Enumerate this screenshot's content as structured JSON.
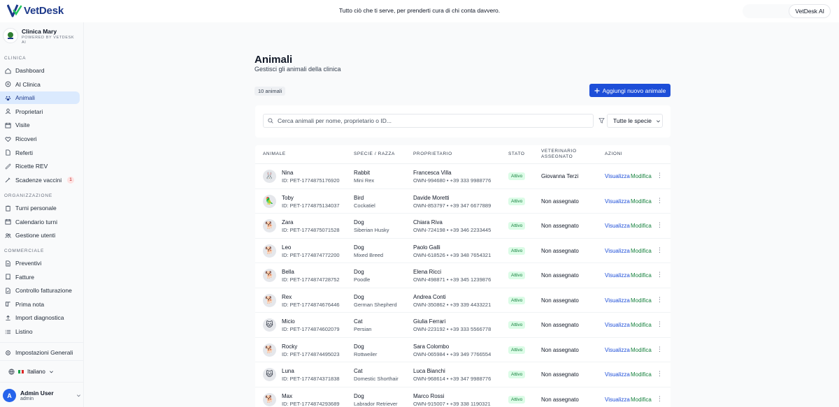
{
  "brand": {
    "name": "VetDesk",
    "tagline": "Tutto ciò che ti serve, per prenderti cura di chi conta davvero.",
    "ai_button": "VetDesk AI"
  },
  "clinic": {
    "name": "Clinica Mary",
    "powered": "POWERED BY VETDESK AI"
  },
  "nav": {
    "section_clinica": "CLINICA",
    "section_organizzazione": "ORGANIZZAZIONE",
    "section_commerciale": "COMMERCIALE",
    "clinica": [
      {
        "label": "Dashboard",
        "icon": "home-icon"
      },
      {
        "label": "AI Clinica",
        "icon": "ai-icon"
      },
      {
        "label": "Animali",
        "icon": "paw-icon"
      },
      {
        "label": "Proprietari",
        "icon": "user-icon"
      },
      {
        "label": "Visite",
        "icon": "calendar-icon"
      },
      {
        "label": "Ricoveri",
        "icon": "heart-icon"
      },
      {
        "label": "Referti",
        "icon": "file-icon"
      },
      {
        "label": "Ricette REV",
        "icon": "pill-icon"
      },
      {
        "label": "Scadenze vaccini",
        "icon": "syringe-icon",
        "badge": "1"
      }
    ],
    "organizzazione": [
      {
        "label": "Turni personale",
        "icon": "clipboard-icon"
      },
      {
        "label": "Calendario turni",
        "icon": "calendar-icon"
      },
      {
        "label": "Gestione utenti",
        "icon": "users-icon"
      }
    ],
    "commerciale": [
      {
        "label": "Preventivi",
        "icon": "document-icon"
      },
      {
        "label": "Fatture",
        "icon": "invoice-icon"
      },
      {
        "label": "Controllo fatturazione",
        "icon": "check-file-icon"
      },
      {
        "label": "Prima nota",
        "icon": "book-icon"
      },
      {
        "label": "Import diagnostica",
        "icon": "upload-icon"
      },
      {
        "label": "Listino",
        "icon": "list-icon"
      }
    ],
    "settings": "Impostazioni Generali",
    "language": "Italiano"
  },
  "user": {
    "initial": "A",
    "name": "Admin User",
    "role": "admin"
  },
  "page": {
    "title": "Animali",
    "subtitle": "Gestisci gli animali della clinica",
    "count": "10 animali",
    "add_button": "Aggiungi nuovo animale",
    "search_placeholder": "Cerca animali per nome, proprietario o ID...",
    "species_filter": "Tutte le specie"
  },
  "table": {
    "headers": {
      "animal": "ANIMALE",
      "species": "SPECIE / RAZZA",
      "owner": "PROPRIETARIO",
      "status": "STATO",
      "vet": "VETERINARIO ASSEGNATO",
      "actions": "AZIONI"
    },
    "view_label": "Visualizza",
    "edit_label": "Modifica",
    "rows": [
      {
        "name": "Nina",
        "id": "ID: PET-1774875176920",
        "species": "Rabbit",
        "breed": "Mini Rex",
        "owner": "Francesca Villa",
        "owner_info": "OWN-994680 • +39 333 9988776",
        "status": "Attivo",
        "vet": "Giovanna Terzi",
        "emoji": "🐰"
      },
      {
        "name": "Toby",
        "id": "ID: PET-1774875134037",
        "species": "Bird",
        "breed": "Cockatiel",
        "owner": "Davide Moretti",
        "owner_info": "OWN-853797 • +39 347 6677889",
        "status": "Attivo",
        "vet": "Non assegnato",
        "emoji": "🦜"
      },
      {
        "name": "Zara",
        "id": "ID: PET-1774875071528",
        "species": "Dog",
        "breed": "Siberian Husky",
        "owner": "Chiara Riva",
        "owner_info": "OWN-724198 • +39 346 2233445",
        "status": "Attivo",
        "vet": "Non assegnato",
        "emoji": "🐕"
      },
      {
        "name": "Leo",
        "id": "ID: PET-1774874772200",
        "species": "Dog",
        "breed": "Mixed Breed",
        "owner": "Paolo Galli",
        "owner_info": "OWN-618526 • +39 348 7654321",
        "status": "Attivo",
        "vet": "Non assegnato",
        "emoji": "🐕"
      },
      {
        "name": "Bella",
        "id": "ID: PET-1774874728752",
        "species": "Dog",
        "breed": "Poodle",
        "owner": "Elena Ricci",
        "owner_info": "OWN-498871 • +39 345 1239876",
        "status": "Attivo",
        "vet": "Non assegnato",
        "emoji": "🐕"
      },
      {
        "name": "Rex",
        "id": "ID: PET-1774874676446",
        "species": "Dog",
        "breed": "German Shepherd",
        "owner": "Andrea Conti",
        "owner_info": "OWN-350862 • +39 339 4433221",
        "status": "Attivo",
        "vet": "Non assegnato",
        "emoji": "🐕"
      },
      {
        "name": "Micio",
        "id": "ID: PET-1774874602079",
        "species": "Cat",
        "breed": "Persian",
        "owner": "Giulia Ferrari",
        "owner_info": "OWN-223192 • +39 333 5566778",
        "status": "Attivo",
        "vet": "Non assegnato",
        "emoji": "🐱"
      },
      {
        "name": "Rocky",
        "id": "ID: PET-1774874495023",
        "species": "Dog",
        "breed": "Rottweiler",
        "owner": "Sara Colombo",
        "owner_info": "OWN-065984 • +39 349 7766554",
        "status": "Attivo",
        "vet": "Non assegnato",
        "emoji": "🐕"
      },
      {
        "name": "Luna",
        "id": "ID: PET-1774874371838",
        "species": "Cat",
        "breed": "Domestic Shorthair",
        "owner": "Luca Bianchi",
        "owner_info": "OWN-968614 • +39 347 9988776",
        "status": "Attivo",
        "vet": "Non assegnato",
        "emoji": "🐱"
      },
      {
        "name": "Max",
        "id": "ID: PET-1774874293689",
        "species": "Dog",
        "breed": "Labrador Retriever",
        "owner": "Marco Rossi",
        "owner_info": "OWN-915007 • +39 338 1190321",
        "status": "Attivo",
        "vet": "Non assegnato",
        "emoji": "🐕"
      }
    ]
  },
  "colors": {
    "accent": "#1d4ed8",
    "active_nav": "#dbeafe",
    "status_bg": "#dcfce7",
    "status_text": "#15803d",
    "edit_text": "#15803d"
  }
}
